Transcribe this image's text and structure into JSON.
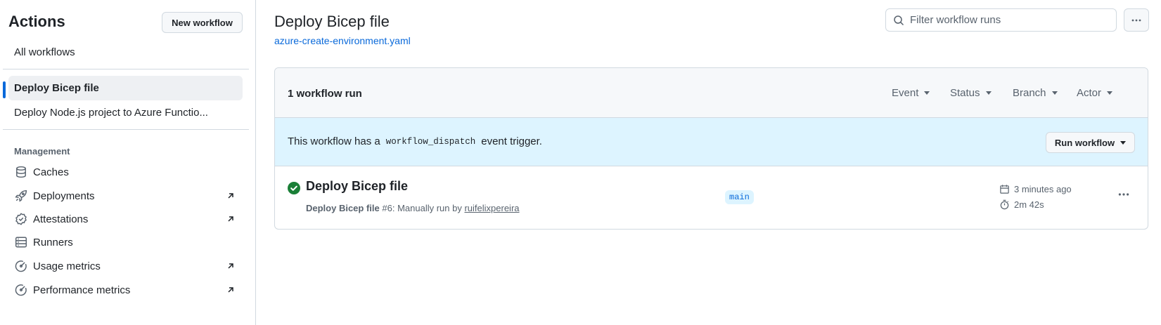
{
  "sidebar": {
    "title": "Actions",
    "new_workflow_label": "New workflow",
    "all_workflows_label": "All workflows",
    "workflows": [
      {
        "label": "Deploy Bicep file",
        "active": true
      },
      {
        "label": "Deploy Node.js project to Azure Functio...",
        "active": false
      }
    ],
    "management_heading": "Management",
    "management_items": [
      {
        "label": "Caches",
        "icon": "database-icon",
        "external": false
      },
      {
        "label": "Deployments",
        "icon": "rocket-icon",
        "external": true
      },
      {
        "label": "Attestations",
        "icon": "verified-icon",
        "external": true
      },
      {
        "label": "Runners",
        "icon": "server-icon",
        "external": false
      },
      {
        "label": "Usage metrics",
        "icon": "meter-icon",
        "external": true
      },
      {
        "label": "Performance metrics",
        "icon": "meter-icon",
        "external": true
      }
    ]
  },
  "header": {
    "title": "Deploy Bicep file",
    "workflow_file": "azure-create-environment.yaml",
    "filter_placeholder": "Filter workflow runs"
  },
  "runs_panel": {
    "count_label": "1 workflow run",
    "filters": [
      "Event",
      "Status",
      "Branch",
      "Actor"
    ],
    "dispatch_prefix": "This workflow has a",
    "dispatch_code": "workflow_dispatch",
    "dispatch_suffix": "event trigger.",
    "run_workflow_label": "Run workflow"
  },
  "runs": [
    {
      "title": "Deploy Bicep file",
      "workflow": "Deploy Bicep file",
      "number": "#6",
      "meta": ": Manually run by",
      "actor": "ruifelixpereira",
      "branch": "main",
      "time_ago": "3 minutes ago",
      "duration": "2m 42s",
      "status": "success"
    }
  ],
  "colors": {
    "accent": "#0969da",
    "success": "#1a7f37",
    "dispatch_bg": "#ddf4ff",
    "border": "#d1d9e0"
  }
}
